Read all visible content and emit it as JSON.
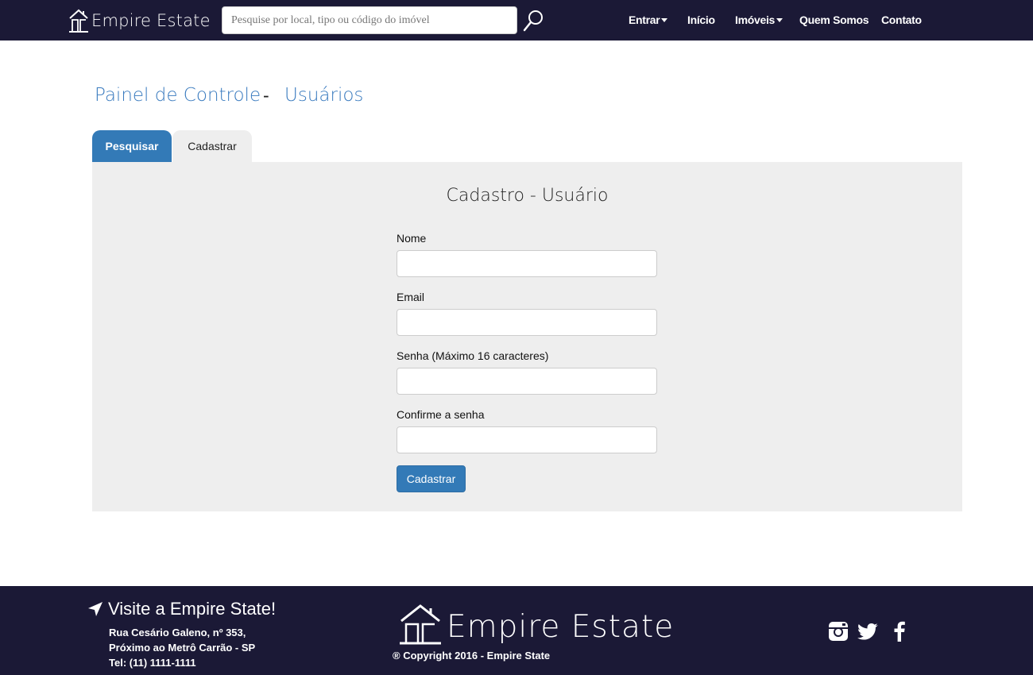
{
  "navbar": {
    "brand": "Empire Estate",
    "search_placeholder": "Pesquise por local, tipo ou código do imóvel",
    "items": [
      {
        "label": "Entrar",
        "has_caret": true
      },
      {
        "label": "Início",
        "has_caret": false
      },
      {
        "label": "Imóveis",
        "has_caret": true
      },
      {
        "label": "Quem Somos",
        "has_caret": false
      },
      {
        "label": "Contato",
        "has_caret": false
      }
    ]
  },
  "breadcrumb": {
    "first": "Painel de Controle",
    "separator": "-",
    "second": "Usuários"
  },
  "tabs": {
    "search": "Pesquisar",
    "register": "Cadastrar"
  },
  "form": {
    "title": "Cadastro - Usuário",
    "fields": [
      {
        "label": "Nome",
        "value": ""
      },
      {
        "label": "Email",
        "value": ""
      },
      {
        "label": "Senha (Máximo 16 caracteres)",
        "value": ""
      },
      {
        "label": "Confirme a senha",
        "value": ""
      }
    ],
    "submit_label": "Cadastrar"
  },
  "footer": {
    "heading": "Visite a Empire State!",
    "address": [
      "Rua Cesário Galeno, nº 353,",
      "Próximo ao Metrô Carrão - SP",
      "Tel: (11) 1111-1111"
    ],
    "brand": "Empire Estate",
    "copyright": "® Copyright 2016 - Empire State",
    "social": [
      "instagram-icon",
      "twitter-icon",
      "facebook-icon"
    ]
  },
  "colors": {
    "navbar_bg": "#1b1936",
    "accent": "#337ab7",
    "link": "#3a7bbf",
    "panel_bg": "#eeeeee"
  }
}
